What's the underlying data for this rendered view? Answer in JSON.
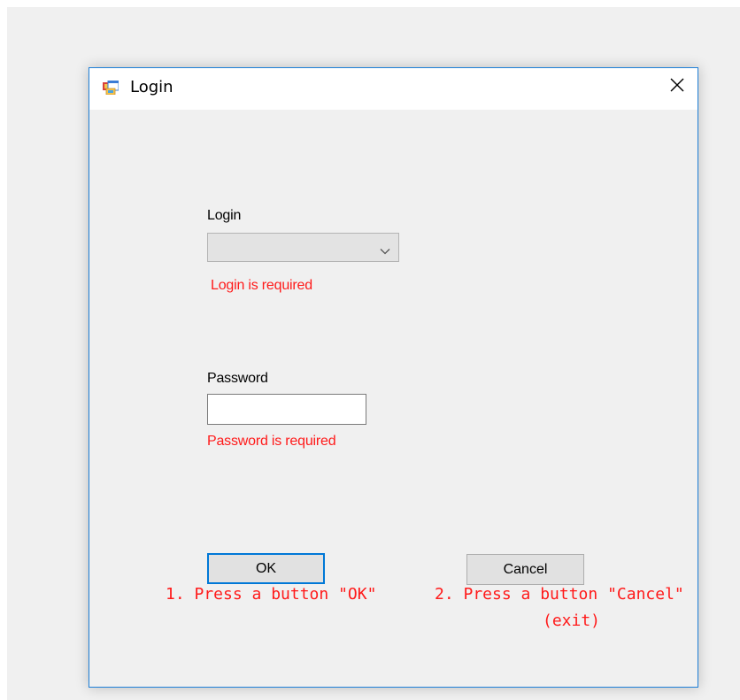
{
  "window": {
    "title": "Login",
    "app_icon": "form-app-icon",
    "close_icon": "close-icon"
  },
  "login": {
    "label": "Login",
    "selected_value": "",
    "error": "Login is required"
  },
  "password": {
    "label": "Password",
    "value": "",
    "error": "Password is required"
  },
  "buttons": {
    "ok_label": "OK",
    "cancel_label": "Cancel"
  },
  "annotations": {
    "ok_hint": "1. Press a button \"OK\"",
    "cancel_hint": "2. Press a button \"Cancel\"",
    "cancel_hint_sub": "(exit)"
  },
  "colors": {
    "error": "#ff1a1a",
    "accent_border": "#1e7fd7",
    "default_button_border": "#0078d7"
  }
}
